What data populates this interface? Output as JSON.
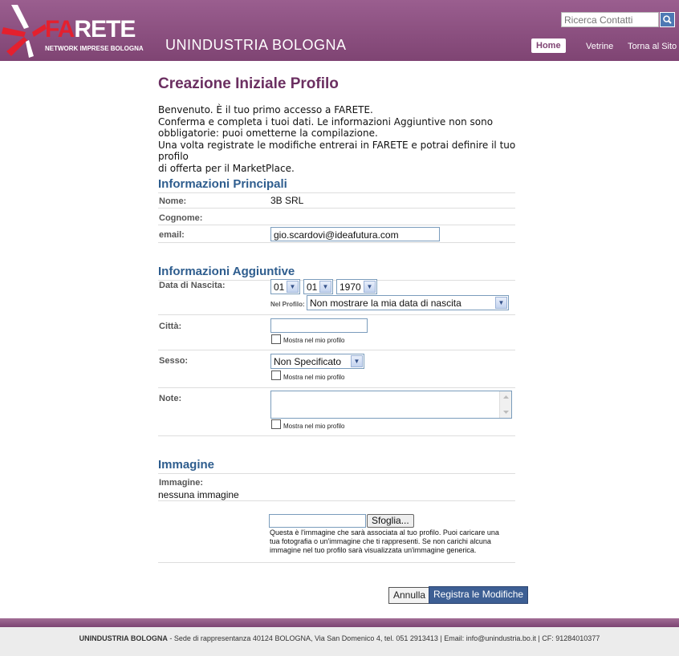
{
  "header": {
    "logo_fa": "FA",
    "logo_rete": "RETE",
    "logo_sub": "NETWORK IMPRESE BOLOGNA",
    "brand": "UNINDUSTRIA BOLOGNA",
    "search_placeholder": "Ricerca Contatti",
    "nav": {
      "home": "Home",
      "vetrine": "Vetrine",
      "torna": "Torna al Sito"
    }
  },
  "page": {
    "title": "Creazione Iniziale Profilo",
    "intro": [
      "Benvenuto. È il tuo primo accesso a FARETE.",
      "Conferma e completa i tuoi dati. Le informazioni Aggiuntive non sono",
      "obbligatorie: puoi ometterne la compilazione.",
      "Una volta registrate le modifiche entrerai in FARETE e potrai definire il tuo profilo",
      "di offerta per il MarketPlace."
    ]
  },
  "principali": {
    "title": "Informazioni Principali",
    "nome_label": "Nome:",
    "nome_value": "3B SRL",
    "cognome_label": "Cognome:",
    "email_label": "email:",
    "email_value": "gio.scardovi@ideafutura.com"
  },
  "aggiuntive": {
    "title": "Informazioni Aggiuntive",
    "nascita_label": "Data di Nascita:",
    "day": "01",
    "month": "01",
    "year": "1970",
    "nel_profilo_label": "Nel Profilo:",
    "nel_profilo_value": "Non mostrare la mia data di nascita",
    "citta_label": "Città:",
    "mostra_label": "Mostra nel mio profilo",
    "sesso_label": "Sesso:",
    "sesso_value": "Non Specificato",
    "note_label": "Note:"
  },
  "immagine": {
    "title": "Immagine",
    "label": "Immagine:",
    "value": "nessuna immagine",
    "browse": "Sfoglia...",
    "help": "Questa è l'immagine che sarà associata al tuo profilo. Puoi caricare una tua fotografia o un'immagine che ti rappresenti. Se non carichi alcuna immagine nel tuo profilo sarà visualizzata un'immagine generica."
  },
  "actions": {
    "annulla": "Annulla",
    "registra": "Registra le Modifiche"
  },
  "footer": {
    "org": "UNINDUSTRIA BOLOGNA",
    "text": " - Sede di rappresentanza 40124 BOLOGNA, Via San Domenico 4, tel. 051 2913413 | Email: info@unindustria.bo.it | CF: 91284010377"
  },
  "colors": {
    "header": "#8b4f80",
    "title": "#6b2f61",
    "section": "#2e5d8e",
    "logo_red": "#e4202e"
  }
}
